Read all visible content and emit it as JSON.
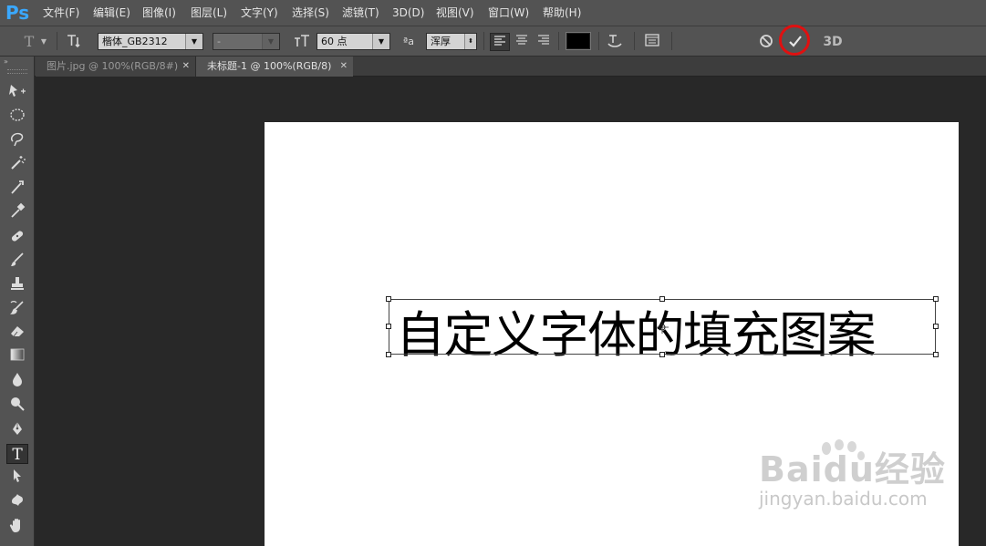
{
  "app": {
    "logo": "Ps"
  },
  "menu": [
    "文件(F)",
    "编辑(E)",
    "图像(I)",
    "图层(L)",
    "文字(Y)",
    "选择(S)",
    "滤镜(T)",
    "3D(D)",
    "视图(V)",
    "窗口(W)",
    "帮助(H)"
  ],
  "options": {
    "tool_icon": "T",
    "font_family": "楷体_GB2312",
    "font_style": "-",
    "font_size": "60 点",
    "antialias_icon_text": "ªa",
    "antialias": "浑厚",
    "three_d_label": "3D",
    "colors": {
      "text_color": "#000000",
      "highlight_ring": "#e01010"
    }
  },
  "tabs": [
    {
      "label": "图片.jpg @ 100%(RGB/8#)",
      "active": false
    },
    {
      "label": "未标题-1 @ 100%(RGB/8)",
      "active": true
    }
  ],
  "canvas": {
    "text": "自定义字体的填充图案"
  },
  "watermark": {
    "brand": "Baidu经验",
    "url": "jingyan.baidu.com"
  },
  "icons": {
    "move": "move-icon",
    "marquee": "elliptical-marquee-icon",
    "lasso": "lasso-icon",
    "magic": "magic-wand-icon",
    "crop": "crop-icon",
    "eyedropper": "eyedropper-icon",
    "healing": "healing-brush-icon",
    "brush": "brush-icon",
    "stamp": "clone-stamp-icon",
    "history": "history-brush-icon",
    "eraser": "eraser-icon",
    "gradient": "gradient-icon",
    "blur": "blur-icon",
    "dodge": "dodge-icon",
    "pen": "pen-icon",
    "type": "type-icon",
    "path": "path-selection-icon",
    "shape": "custom-shape-icon",
    "hand": "hand-icon"
  }
}
